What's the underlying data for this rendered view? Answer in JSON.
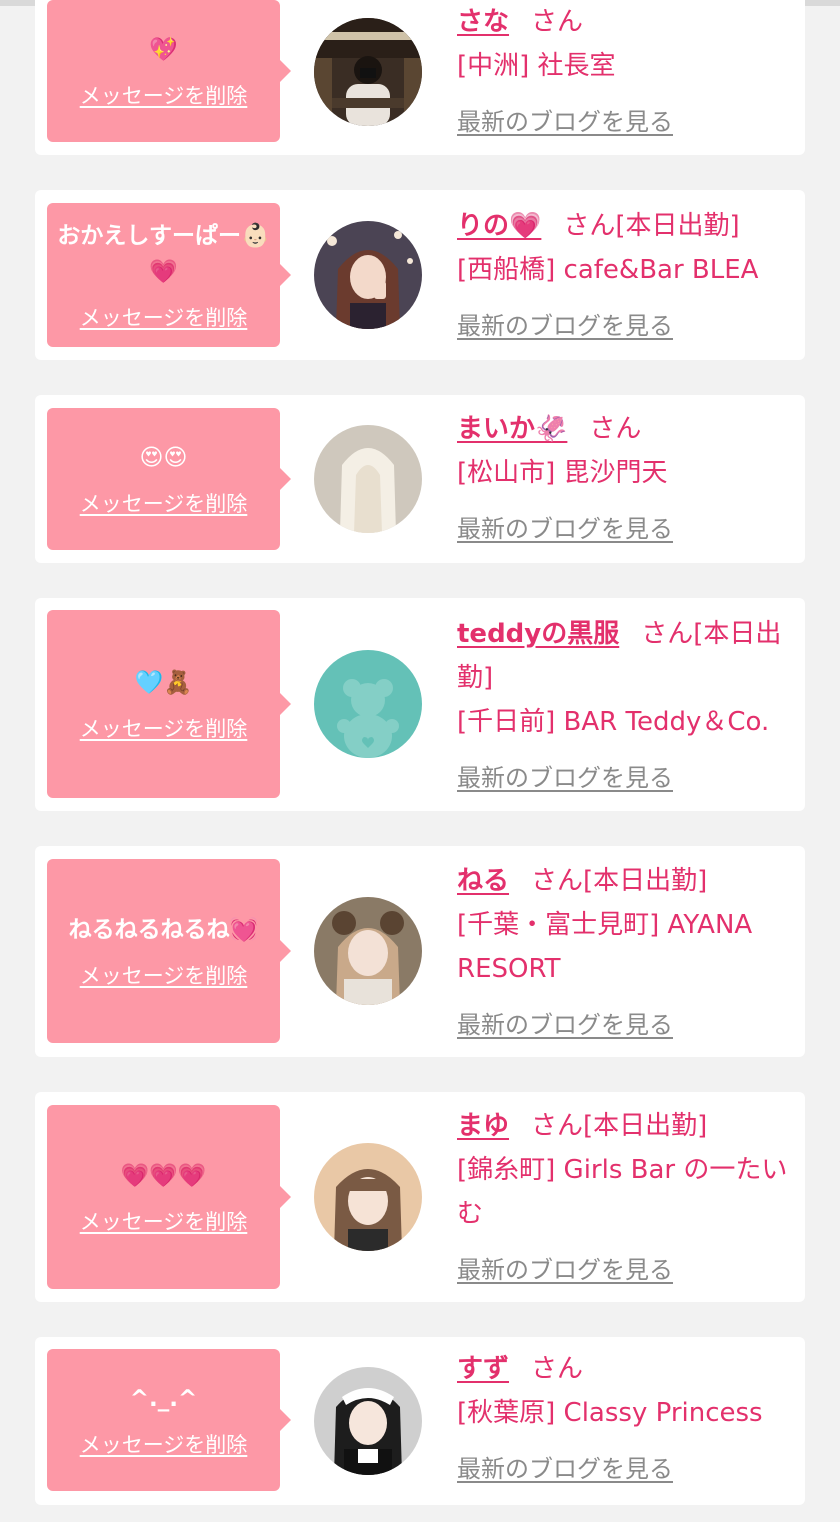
{
  "common": {
    "delete_label": "メッセージを削除",
    "blog_label": "最新のブログを見る",
    "honorific": "さん"
  },
  "colors": {
    "page_bg": "#f2f2f2",
    "bubble": "#fd98a6",
    "accent": "#e3306c",
    "link_gray": "#8a8a8a"
  },
  "cards": [
    {
      "message": "💖",
      "name": "さな",
      "status": "",
      "shop": "[中洲] 社長室",
      "avatar": "photo-woman-library"
    },
    {
      "message": "おかえしすーぱー👶🏻💗",
      "name": "りの💗",
      "status": "[本日出勤]",
      "shop": "[西船橋] cafe&Bar BLEA",
      "avatar": "photo-woman-selfie"
    },
    {
      "message": "😍😍",
      "name": "まいか🦑",
      "status": "",
      "shop": "[松山市] 毘沙門天",
      "avatar": "photo-blonde-hair"
    },
    {
      "message": "🩵🧸",
      "name": "teddyの黒服",
      "status": "[本日出勤]",
      "shop": "[千日前] BAR Teddy＆Co.",
      "avatar": "teddy-bear-default-icon"
    },
    {
      "message": "ねるねるねるね💓",
      "name": "ねる",
      "status": "[本日出勤]",
      "shop": "[千葉・富士見町] AYANA RESORT",
      "avatar": "photo-bear-ears"
    },
    {
      "message": "💗💗💗",
      "name": "まゆ",
      "status": "[本日出勤]",
      "shop": "[錦糸町] Girls Bar の一たいむ",
      "avatar": "photo-woman-bangs"
    },
    {
      "message": "^._.^",
      "name": "すず",
      "status": "",
      "shop": "[秋葉原] Classy Princess",
      "avatar": "photo-maid-outfit"
    }
  ]
}
